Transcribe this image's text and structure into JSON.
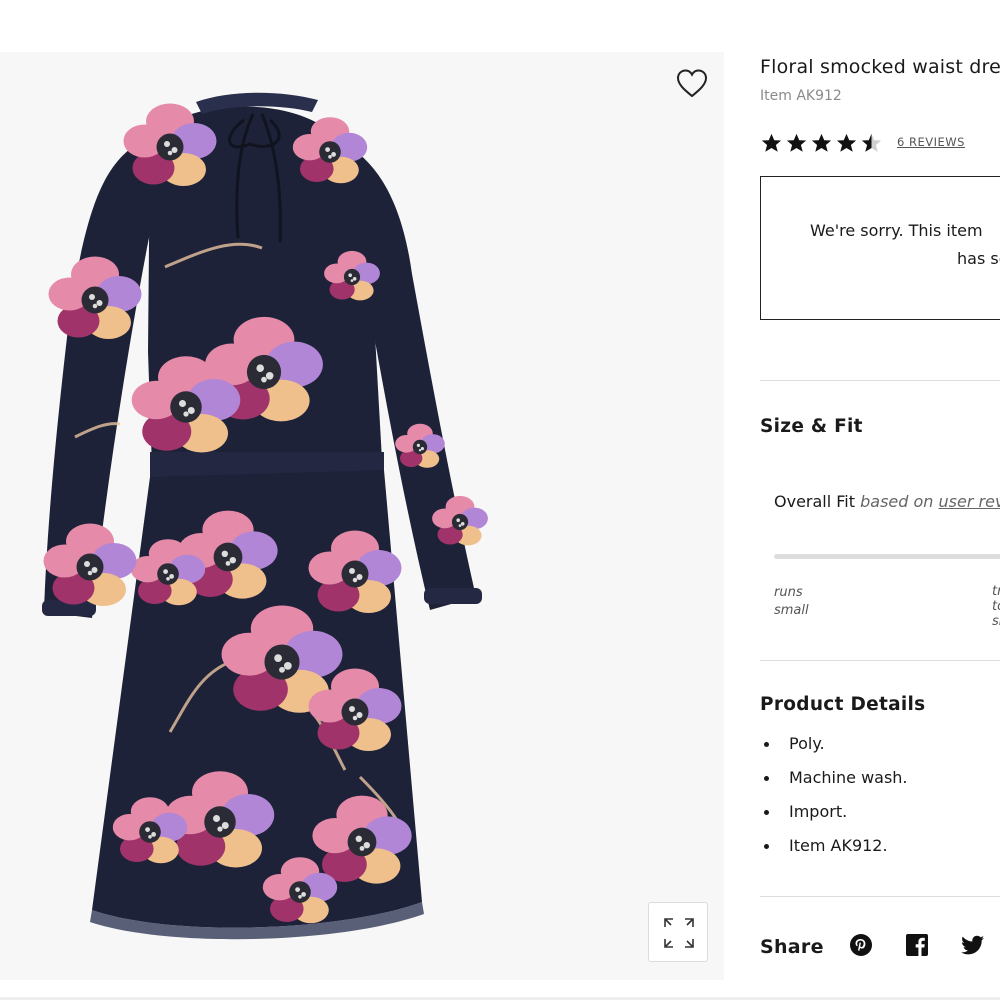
{
  "product": {
    "title": "Floral smocked waist dress",
    "item_number": "Item AK912",
    "rating": 4.5,
    "reviews_label": "6 REVIEWS",
    "favorite_icon": "heart-outline-icon",
    "zoom_icon": "expand-icon"
  },
  "availability": {
    "line1": "We're sorry. This item",
    "line2": "has sold out."
  },
  "size_fit": {
    "heading": "Size & Fit",
    "overall_fit": "Overall Fit",
    "based_on": "based on",
    "user_reviews": "user reviews",
    "runs_small_1": "runs",
    "runs_small_2": "small",
    "right_label": "true to size"
  },
  "details": {
    "heading": "Product Details",
    "items": [
      "Poly.",
      "Machine wash.",
      "Import.",
      "Item AK912."
    ]
  },
  "share": {
    "label": "Share",
    "icons": [
      "pinterest-icon",
      "facebook-icon",
      "twitter-icon"
    ]
  },
  "colors": {
    "dress_base": "#1e2238",
    "flower_pink": "#e58aa8",
    "flower_lilac": "#b286d6",
    "flower_magenta": "#a0336a",
    "flower_peach": "#f0c08c",
    "panel_bg": "#f7f7f7"
  }
}
